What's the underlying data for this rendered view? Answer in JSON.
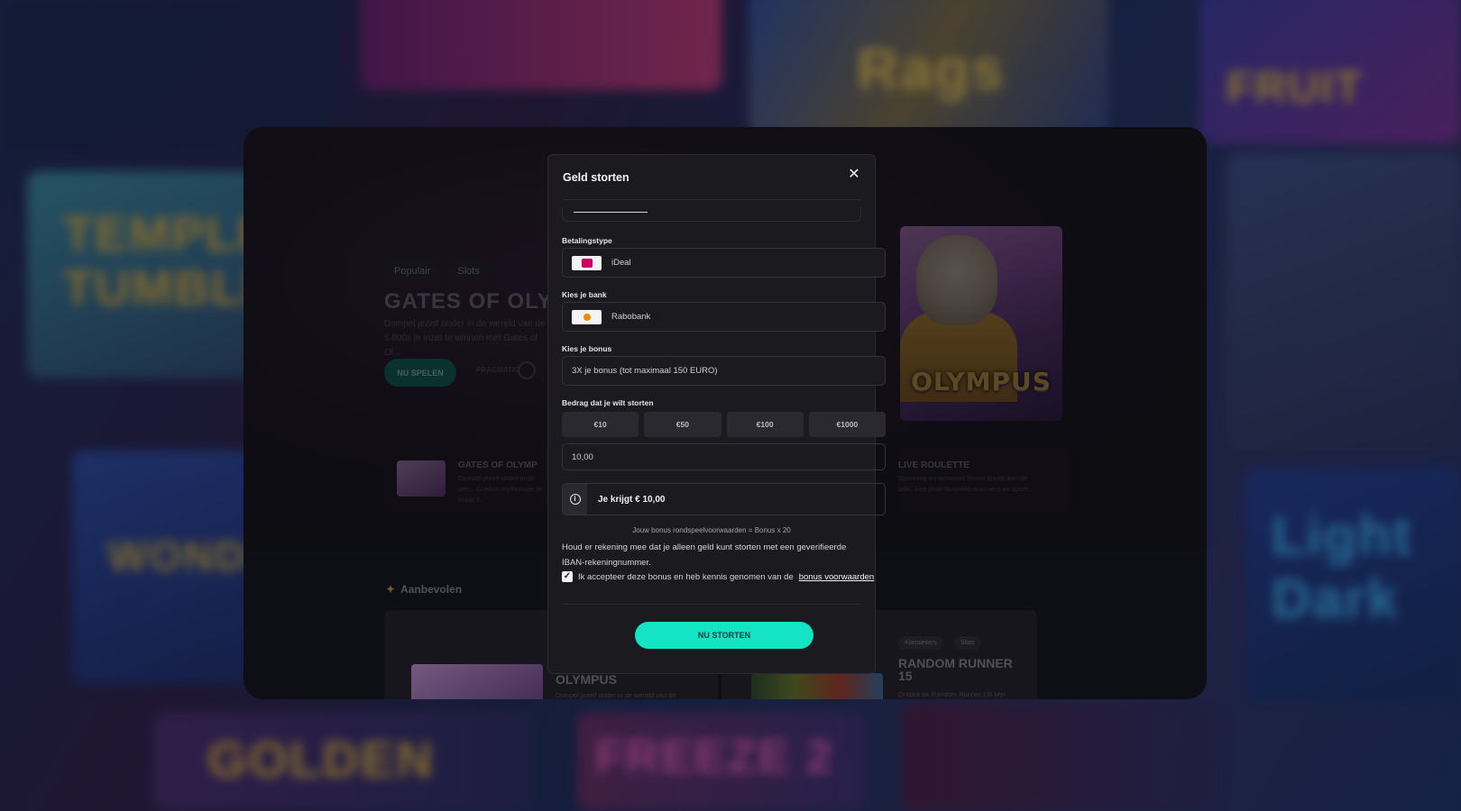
{
  "background": {
    "tiles": [
      "TEMPLE TUMBLE",
      "Rags",
      "FRUIT",
      "Light Dark",
      "GOLDEN",
      "FREEZE 2",
      "WONDER"
    ]
  },
  "hero": {
    "chips": [
      "Populair",
      "Slots"
    ],
    "title": "GATES OF OLY",
    "description": "Dompel jezelf onder in de wereld van de ... 5.000x je inzet te winnen met Gates of Ol...",
    "play_label": "NU SPELEN",
    "provider": "PRAGMATIC",
    "art_logo": "OLYMPUS"
  },
  "strip": {
    "cards": [
      {
        "title": "GATES OF OLYMP",
        "desc": "Dompel jezelf onder in de wer... Griekse mythologie en maak k..."
      },
      {
        "title": "LIVE ROULETTE",
        "desc": "Spanning en sensatie! Neem plaats aan de tafel, kies jouw favoriete nummers en speel..."
      }
    ]
  },
  "recommended": {
    "title": "Aanbevolen",
    "card1": {
      "title": "OLYMPUS",
      "desc": "Dompel jezelf onder in de wereld van de"
    },
    "card2": {
      "chips": [
        "Klassiekers",
        "Slots"
      ],
      "title_line1": "RANDOM RUNNER",
      "title_line2": "15",
      "desc": "Ontdek de Random Runner 15! Met"
    }
  },
  "modal": {
    "title": "Geld storten",
    "close_icon": "close-icon",
    "payment_type_label": "Betalingstype",
    "payment_type_value": "iDeal",
    "bank_label": "Kies je bank",
    "bank_value": "Rabobank",
    "bonus_label": "Kies je bonus",
    "bonus_value": "3X je bonus (tot maximaal 150 EURO)",
    "amount_label": "Bedrag dat je wilt storten",
    "amount_options": [
      "€10",
      "€50",
      "€100",
      "€1000"
    ],
    "amount_value": "10,00",
    "receive_text": "Je krijgt € 10,00",
    "wager_note": "Jouw bonus rondspeelvoorwaarden = Bonus x 20",
    "iban_note": "Houd er rekening mee dat je alleen geld kunt storten met een geverifieerde IBAN-rekeningnummer.",
    "accept_text": "Ik accepteer deze bonus en heb kennis genomen van de",
    "accept_link": "bonus voorwaarden",
    "accept_checked": true,
    "submit_label": "NU STORTEN"
  },
  "colors": {
    "accent": "#14e3c4",
    "modal_bg": "#1b1a1f"
  }
}
